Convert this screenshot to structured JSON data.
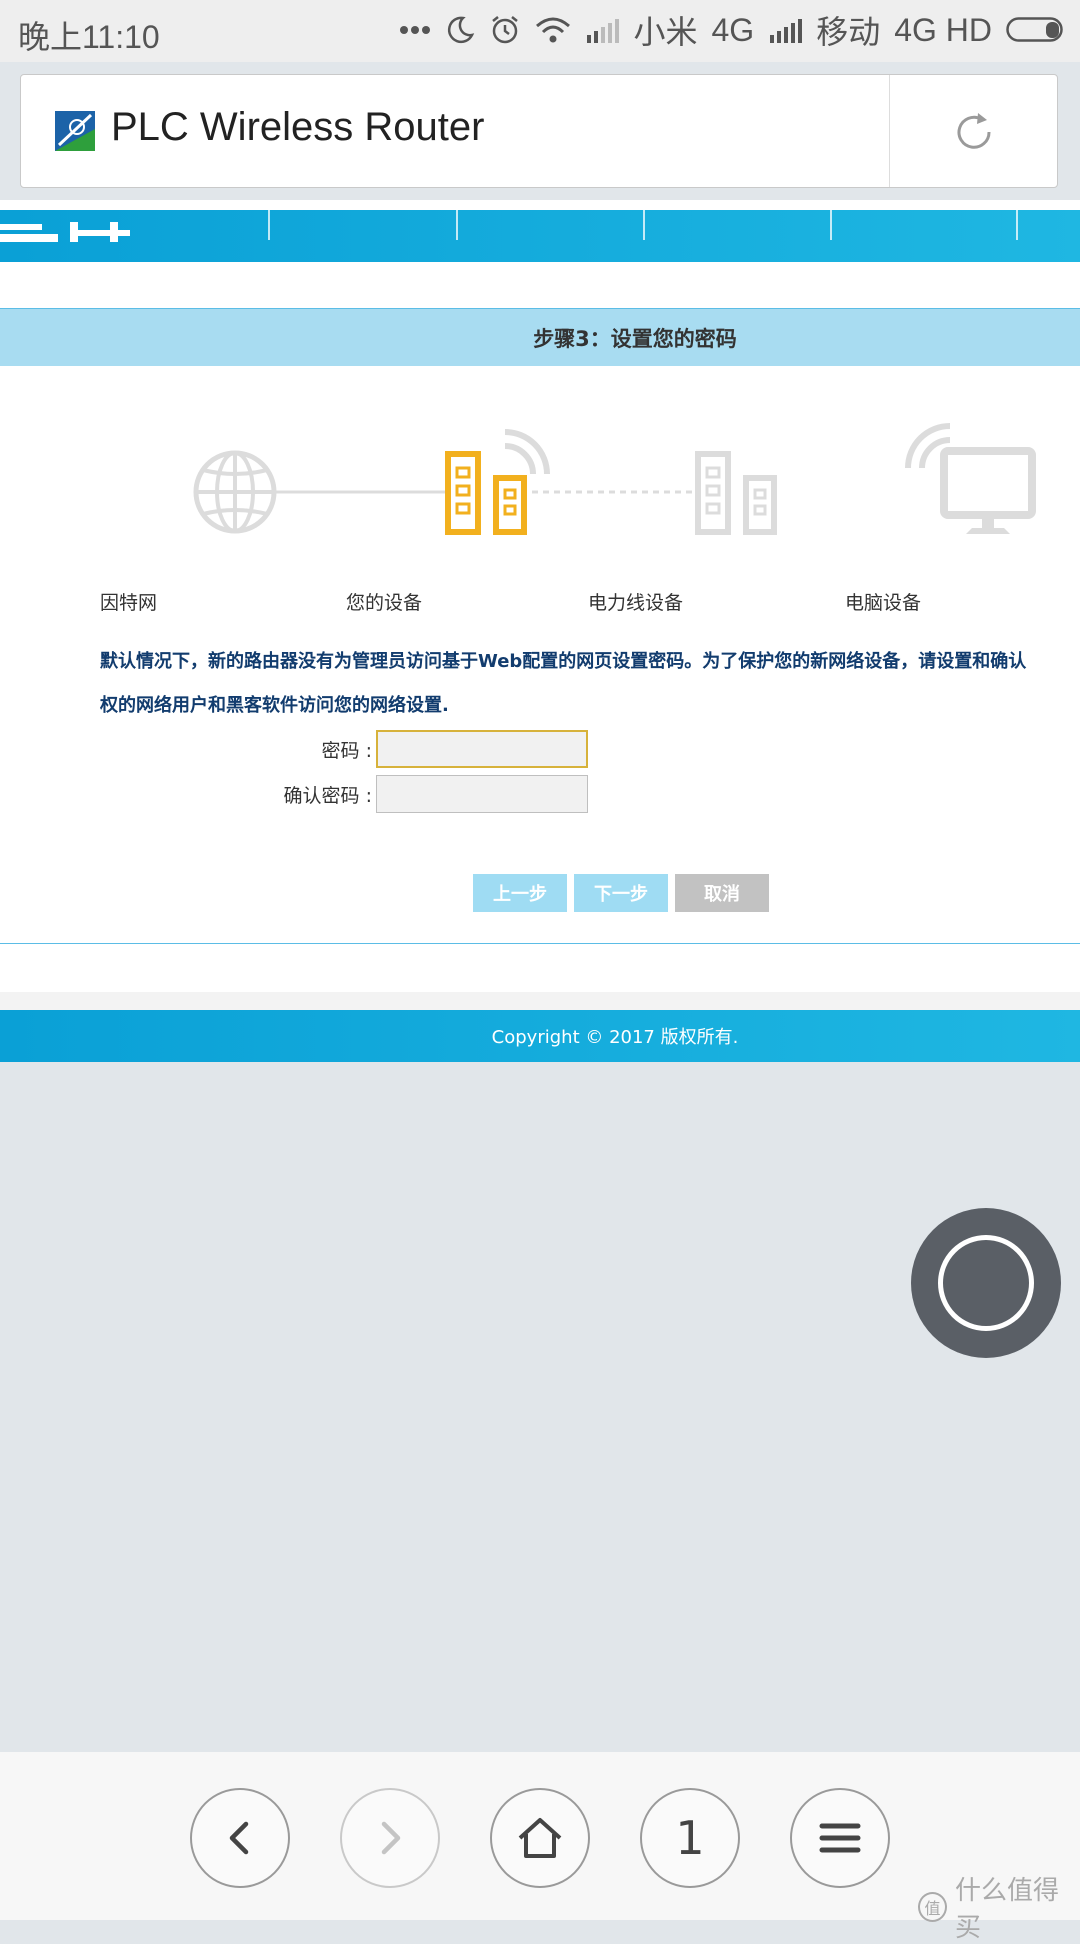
{
  "status_bar": {
    "time": "晚上11:10",
    "carrier1": "小米",
    "network1": "4G",
    "carrier2": "移动",
    "network2": "4G HD"
  },
  "address_bar": {
    "title": "PLC Wireless Router",
    "favicon": "router-logo-icon",
    "reload_icon": "reload-icon"
  },
  "page": {
    "step_title": "步骤3：设置您的密码",
    "nodes": [
      {
        "label": "因特网",
        "icon": "globe-icon"
      },
      {
        "label": "您的设备",
        "icon": "router-device-icon"
      },
      {
        "label": "电力线设备",
        "icon": "powerline-device-icon"
      },
      {
        "label": "电脑设备",
        "icon": "computer-monitor-icon"
      }
    ],
    "description_line1": "默认情况下，新的路由器没有为管理员访问基于Web配置的网页设置密码。为了保护您的新网络设备，请设置和确认",
    "description_line2": "权的网络用户和黑客软件访问您的网络设置.",
    "password_label": "密码 :",
    "confirm_label": "确认密码 :",
    "password_value": "",
    "confirm_value": "",
    "btn_prev": "上一步",
    "btn_next": "下一步",
    "btn_cancel": "取消",
    "copyright": "Copyright © 2017 版权所有.",
    "active_color": "#f2b01e",
    "inactive_color": "#dcdcdc",
    "banner_color": "#0aa0d6"
  },
  "bottom_nav": {
    "back_icon": "back-arrow-icon",
    "forward_icon": "forward-arrow-icon",
    "home_icon": "home-icon",
    "tab_count": "1",
    "menu_icon": "menu-icon"
  },
  "watermark": {
    "badge": "值",
    "text": "什么值得买"
  }
}
